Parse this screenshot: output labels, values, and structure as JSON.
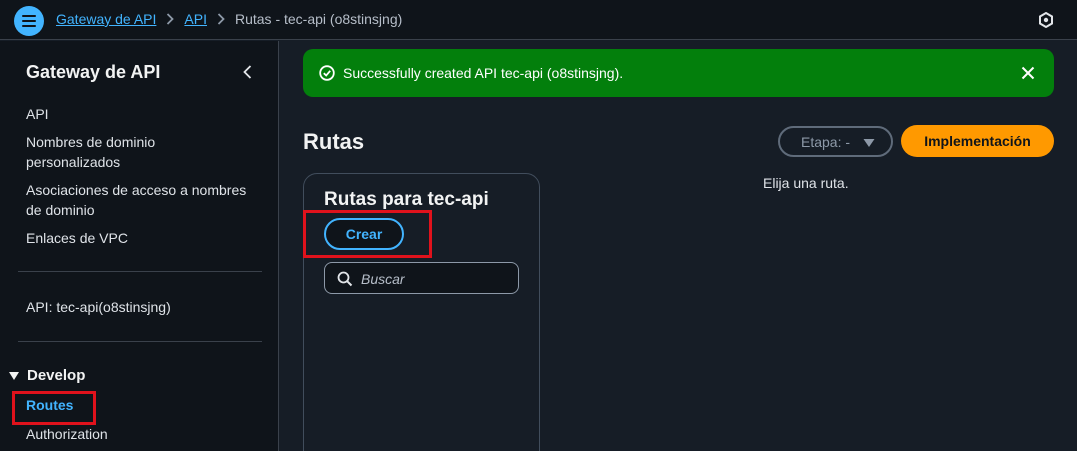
{
  "breadcrumb": {
    "items": [
      "Gateway de API",
      "API"
    ],
    "current": "Rutas - tec-api (o8stinsjng)"
  },
  "sidebar": {
    "title": "Gateway de API",
    "links": [
      {
        "label": "API"
      },
      {
        "label": "Nombres de dominio personalizados"
      },
      {
        "label": "Asociaciones de acceso a nombres de dominio"
      },
      {
        "label": "Enlaces de VPC"
      }
    ],
    "api_label": "API: tec-api(o8stinsjng)",
    "develop": {
      "label": "Develop",
      "items": [
        "Routes",
        "Authorization"
      ]
    }
  },
  "flash": {
    "message": "Successfully created API tec-api (o8stinsjng).",
    "status_color": "#037f0c"
  },
  "main": {
    "title": "Rutas",
    "stage_label": "Etapa: -",
    "deploy_label": "Implementación",
    "empty_hint": "Elija una ruta."
  },
  "routes_panel": {
    "title": "Rutas para tec-api",
    "create_label": "Crear",
    "search_placeholder": "Buscar"
  },
  "colors": {
    "accent": "#42b4ff",
    "primary_button": "#ff9900",
    "highlight_box": "#e0121c"
  }
}
